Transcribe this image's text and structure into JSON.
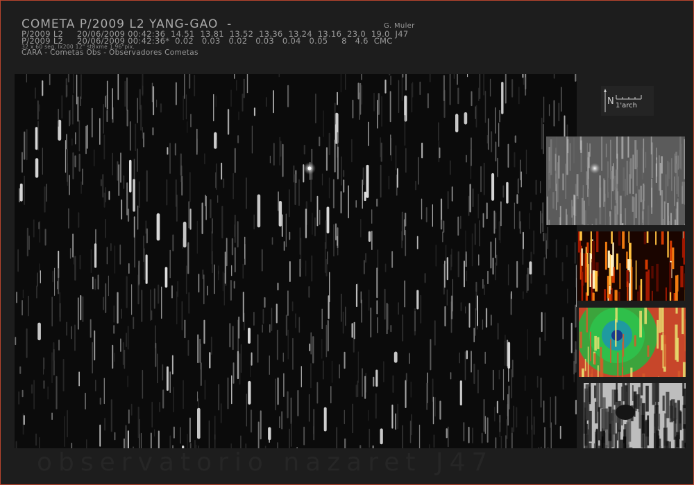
{
  "header": {
    "title": "COMETA P/2009 L2 YANG-GAO  -",
    "author": "G. Muler",
    "row1": "P/2009 L2     20/06/2009 00:42:36  14.51  13.81  13.52  13.36  13.24  13.16  23.0  19.0  J47",
    "row2": "P/2009 L2     20/06/2009 00:42:36*  0.02   0.03   0.02   0.03   0.04   0.05     8   4.6  CMC",
    "exposure": "32 x 60 seg. lx200 12\" st8xme 1.96\"pix.",
    "org": "CARA - Cometas Obs - Observadores Cometas"
  },
  "orientation": {
    "north": "N",
    "scale": "1'arch"
  },
  "footer": {
    "text": "observatorio nazaret J47"
  },
  "colors": {
    "frame_border": "#b8452e",
    "background": "#1d1d1d",
    "header_text": "#a9a9a9"
  }
}
